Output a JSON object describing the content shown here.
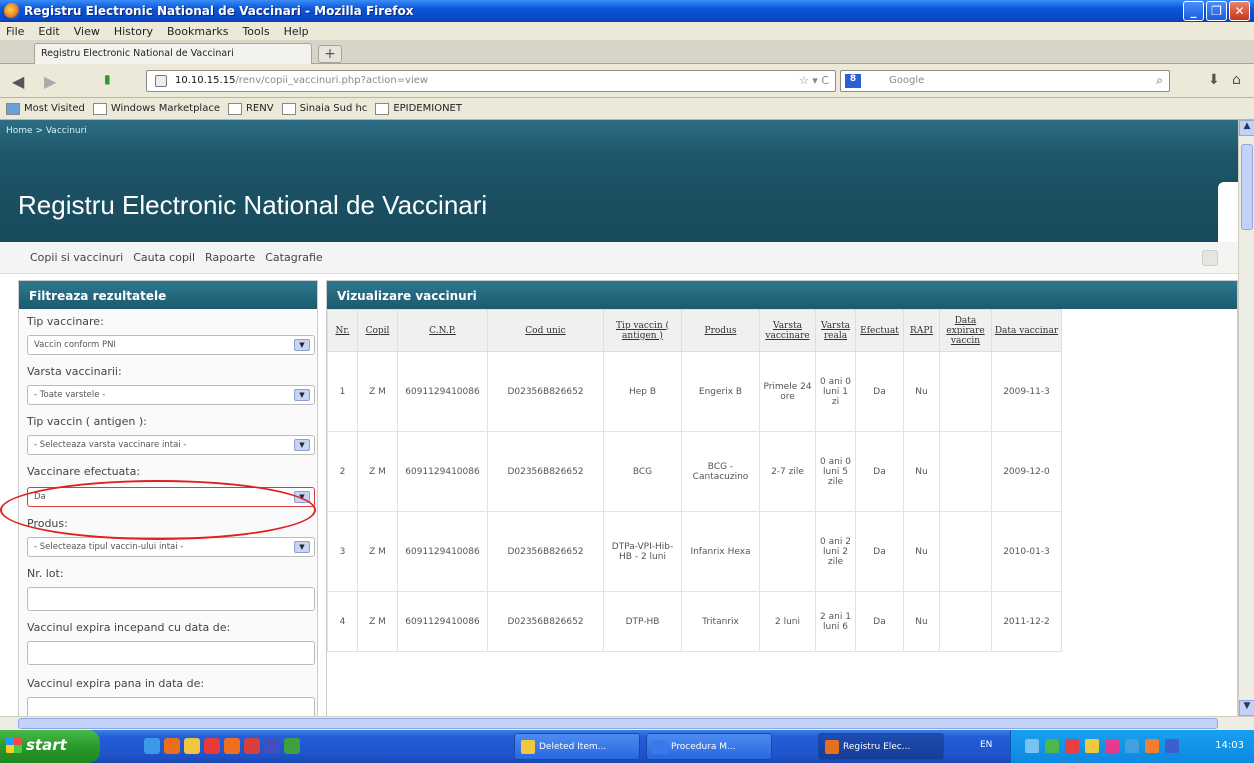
{
  "window": {
    "title": "Registru Electronic National de Vaccinari - Mozilla Firefox",
    "buttons": [
      "_",
      "❐",
      "✕"
    ]
  },
  "menu": [
    "File",
    "Edit",
    "View",
    "History",
    "Bookmarks",
    "Tools",
    "Help"
  ],
  "tab": {
    "label": "Registru Electronic National de Vaccinari",
    "new_tab": "+"
  },
  "nav": {
    "url_host": "10.10.15.15",
    "url_path": "/renv/copii_vaccinuri.php?action=view",
    "url_right": "☆ ▾ C",
    "search_engine": "8",
    "search_placeholder": "Google"
  },
  "bookmarks": [
    "Most Visited",
    "Windows Marketplace",
    "RENV",
    "Sinaia Sud hc",
    "EPIDEMIONET"
  ],
  "page": {
    "breadcrumb": "Home > Vaccinuri",
    "title": "Registru Electronic National de Vaccinari",
    "top_menu": [
      "Copii si vaccinuri",
      "Cauta copil",
      "Rapoarte",
      "Catagrafie"
    ]
  },
  "filter": {
    "heading": "Filtreaza rezultatele",
    "fields": [
      {
        "label": "Tip vaccinare:",
        "value": "Vaccin conform PNI"
      },
      {
        "label": "Varsta vaccinarii:",
        "value": "- Toate varstele -"
      },
      {
        "label": "Tip vaccin ( antigen ):",
        "value": "- Selecteaza varsta vaccinare intai -"
      },
      {
        "label": "Vaccinare efectuata:",
        "value": "Da"
      },
      {
        "label": "Produs:",
        "value": "- Selecteaza tipul vaccin-ului intai -"
      }
    ],
    "lot_label": "Nr. lot:",
    "expire_from_label": "Vaccinul expira incepand cu data de:",
    "expire_to_label": "Vaccinul expira pana in data de:"
  },
  "results": {
    "heading": "Vizualizare vaccinuri",
    "columns": [
      "Nr.",
      "Copil",
      "C.N.P.",
      "Cod unic",
      "Tip vaccin ( antigen )",
      "Produs",
      "Varsta vaccinare",
      "Varsta reala",
      "Efectuat",
      "RAPI",
      "Data expirare vaccin",
      "Data vaccinar"
    ],
    "rows": [
      [
        "1",
        "Z M",
        "6091129410086",
        "D02356B826652",
        "Hep B",
        "Engerix B",
        "Primele 24 ore",
        "0 ani 0 luni 1 zi",
        "Da",
        "Nu",
        "",
        "2009-11-3"
      ],
      [
        "2",
        "Z M",
        "6091129410086",
        "D02356B826652",
        "BCG",
        "BCG - Cantacuzino",
        "2-7 zile",
        "0 ani 0 luni 5 zile",
        "Da",
        "Nu",
        "",
        "2009-12-0"
      ],
      [
        "3",
        "Z M",
        "6091129410086",
        "D02356B826652",
        "DTPa-VPI-Hib-HB - 2 luni",
        "Infanrix Hexa",
        "",
        "0 ani 2 luni 2 zile",
        "Da",
        "Nu",
        "",
        "2010-01-3"
      ],
      [
        "4",
        "Z M",
        "6091129410086",
        "D02356B826652",
        "DTP-HB",
        "Tritanrix",
        "2 luni",
        "2 ani 1 luni 6",
        "Da",
        "Nu",
        "",
        "2011-12-2"
      ]
    ]
  },
  "taskbar": {
    "start": "start",
    "tasks": [
      "Deleted Item...",
      "Procedura M...",
      "Registru Elec..."
    ],
    "lang": "EN",
    "clock": "14:03"
  }
}
